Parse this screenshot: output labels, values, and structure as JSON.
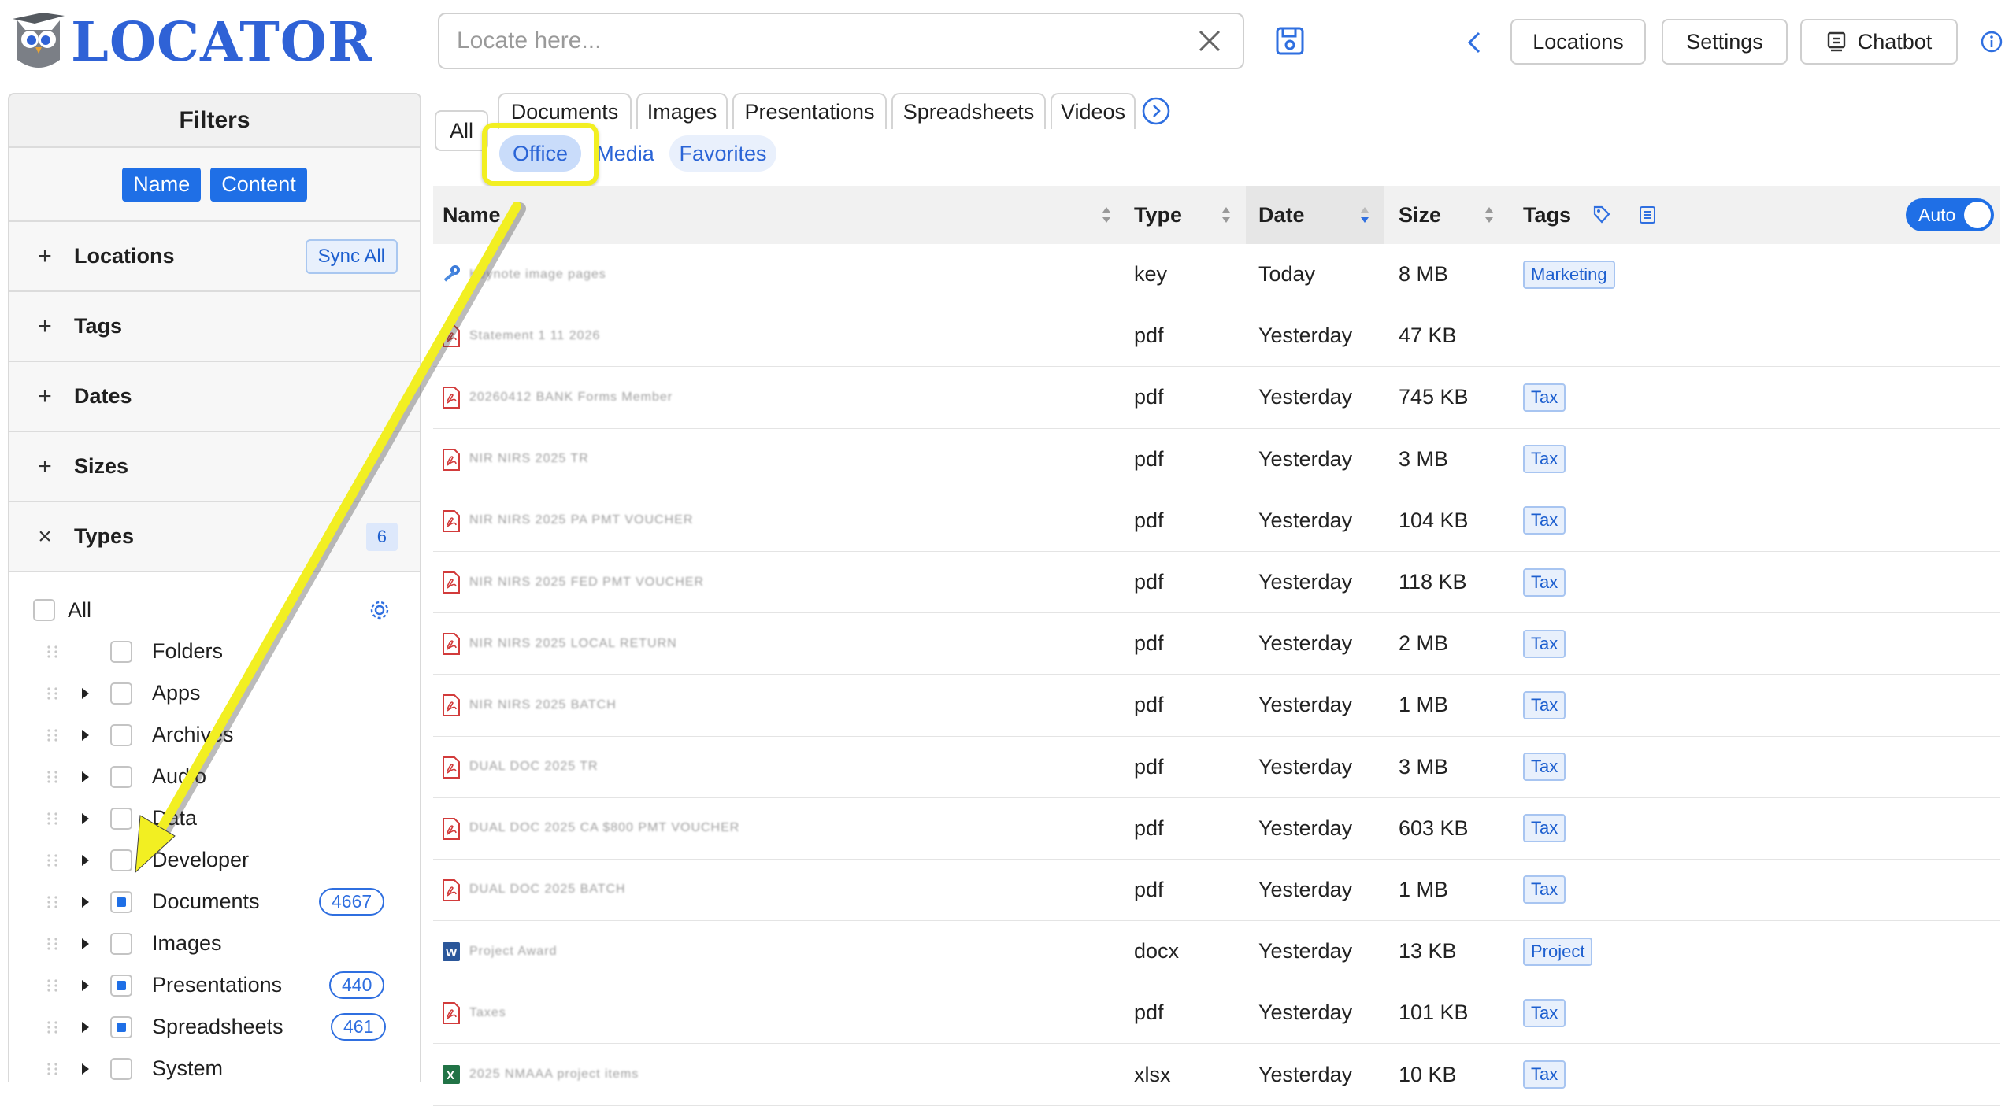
{
  "app": {
    "title": "LOCATOR"
  },
  "search": {
    "placeholder": "Locate here..."
  },
  "header": {
    "locations": "Locations",
    "settings": "Settings",
    "chatbot": "Chatbot"
  },
  "filters": {
    "title": "Filters",
    "modes": [
      "Name",
      "Content"
    ],
    "sections": [
      {
        "label": "Locations",
        "toggle": "+",
        "action": "Sync All"
      },
      {
        "label": "Tags",
        "toggle": "+"
      },
      {
        "label": "Dates",
        "toggle": "+"
      },
      {
        "label": "Sizes",
        "toggle": "+"
      },
      {
        "label": "Types",
        "toggle": "×",
        "count": "6"
      }
    ],
    "types_all": "All",
    "types": [
      {
        "label": "Folders",
        "checked": false,
        "caret": false
      },
      {
        "label": "Apps",
        "checked": false,
        "caret": true
      },
      {
        "label": "Archives",
        "checked": false,
        "caret": true
      },
      {
        "label": "Audio",
        "checked": false,
        "caret": true
      },
      {
        "label": "Data",
        "checked": false,
        "caret": true
      },
      {
        "label": "Developer",
        "checked": false,
        "caret": true
      },
      {
        "label": "Documents",
        "checked": true,
        "caret": true,
        "count": "4667"
      },
      {
        "label": "Images",
        "checked": false,
        "caret": true
      },
      {
        "label": "Presentations",
        "checked": true,
        "caret": true,
        "count": "440"
      },
      {
        "label": "Spreadsheets",
        "checked": true,
        "caret": true,
        "count": "461"
      },
      {
        "label": "System",
        "checked": false,
        "caret": true
      }
    ]
  },
  "tabs": {
    "all": "All",
    "top": [
      "Documents",
      "Images",
      "Presentations",
      "Spreadsheets",
      "Videos"
    ],
    "sub": [
      "Office",
      "Media",
      "Favorites"
    ],
    "active_sub": "Office"
  },
  "table": {
    "headers": {
      "name": "Name",
      "type": "Type",
      "date": "Date",
      "size": "Size",
      "tags": "Tags"
    },
    "auto_toggle": "Auto",
    "rows": [
      {
        "name": "Keynote image pages",
        "icon": "key",
        "type": "key",
        "date": "Today",
        "size": "8 MB",
        "tag": "Marketing"
      },
      {
        "name": "Statement 1 11 2026",
        "icon": "pdf",
        "type": "pdf",
        "date": "Yesterday",
        "size": "47 KB",
        "tag": ""
      },
      {
        "name": "20260412 BANK Forms Member",
        "icon": "pdf",
        "type": "pdf",
        "date": "Yesterday",
        "size": "745 KB",
        "tag": "Tax"
      },
      {
        "name": "NIR NIRS 2025 TR",
        "icon": "pdf",
        "type": "pdf",
        "date": "Yesterday",
        "size": "3 MB",
        "tag": "Tax"
      },
      {
        "name": "NIR NIRS 2025 PA PMT VOUCHER",
        "icon": "pdf",
        "type": "pdf",
        "date": "Yesterday",
        "size": "104 KB",
        "tag": "Tax"
      },
      {
        "name": "NIR NIRS 2025 FED PMT VOUCHER",
        "icon": "pdf",
        "type": "pdf",
        "date": "Yesterday",
        "size": "118 KB",
        "tag": "Tax"
      },
      {
        "name": "NIR NIRS 2025 LOCAL RETURN",
        "icon": "pdf",
        "type": "pdf",
        "date": "Yesterday",
        "size": "2 MB",
        "tag": "Tax"
      },
      {
        "name": "NIR NIRS 2025 BATCH",
        "icon": "pdf",
        "type": "pdf",
        "date": "Yesterday",
        "size": "1 MB",
        "tag": "Tax"
      },
      {
        "name": "DUAL DOC 2025 TR",
        "icon": "pdf",
        "type": "pdf",
        "date": "Yesterday",
        "size": "3 MB",
        "tag": "Tax"
      },
      {
        "name": "DUAL DOC 2025 CA $800 PMT VOUCHER",
        "icon": "pdf",
        "type": "pdf",
        "date": "Yesterday",
        "size": "603 KB",
        "tag": "Tax"
      },
      {
        "name": "DUAL DOC 2025 BATCH",
        "icon": "pdf",
        "type": "pdf",
        "date": "Yesterday",
        "size": "1 MB",
        "tag": "Tax"
      },
      {
        "name": "Project Award",
        "icon": "word",
        "type": "docx",
        "date": "Yesterday",
        "size": "13 KB",
        "tag": "Project"
      },
      {
        "name": "Taxes",
        "icon": "pdf",
        "type": "pdf",
        "date": "Yesterday",
        "size": "101 KB",
        "tag": "Tax"
      },
      {
        "name": "2025 NMAAA project items",
        "icon": "excel",
        "type": "xlsx",
        "date": "Yesterday",
        "size": "10 KB",
        "tag": "Tax"
      }
    ]
  },
  "colors": {
    "accent": "#1f6fe6",
    "highlight": "#f2ef22",
    "pdf": "#d23b3b"
  }
}
